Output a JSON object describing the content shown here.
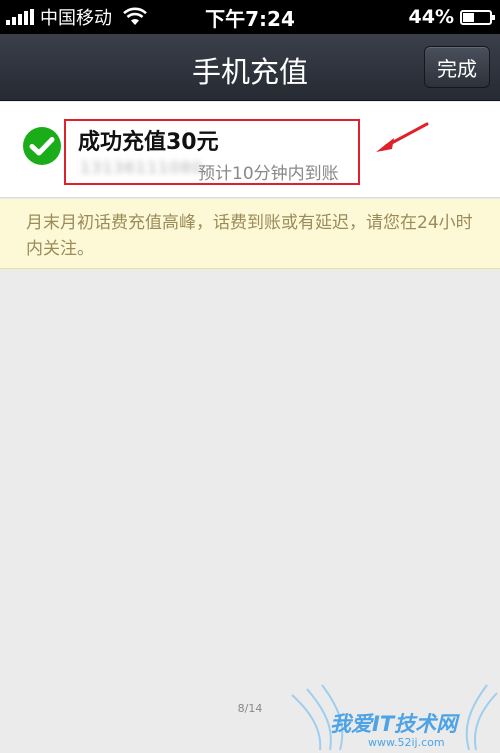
{
  "status_bar": {
    "carrier": "中国移动",
    "time": "下午7:24",
    "battery_percent": "44%",
    "battery_level": 0.44
  },
  "nav": {
    "title": "手机充值",
    "done_label": "完成"
  },
  "result": {
    "title": "成功充值30元",
    "phone_number": "13136111080",
    "eta": "预计10分钟内到账"
  },
  "notice": {
    "text": "月末月初话费充值高峰，话费到账或有延迟，请您在24小时内关注。"
  },
  "page_indicator": "8/14",
  "watermark": {
    "text": "我爱IT技术网",
    "url": "www.52ij.com"
  },
  "colors": {
    "success_green": "#1aad19",
    "highlight_red": "#e0202a",
    "notice_bg": "#fdf8d6",
    "nav_bg": "#2c3039"
  },
  "icons": [
    "signal-icon",
    "wifi-icon",
    "battery-icon",
    "check-circle-icon",
    "arrow-annotation-icon"
  ]
}
